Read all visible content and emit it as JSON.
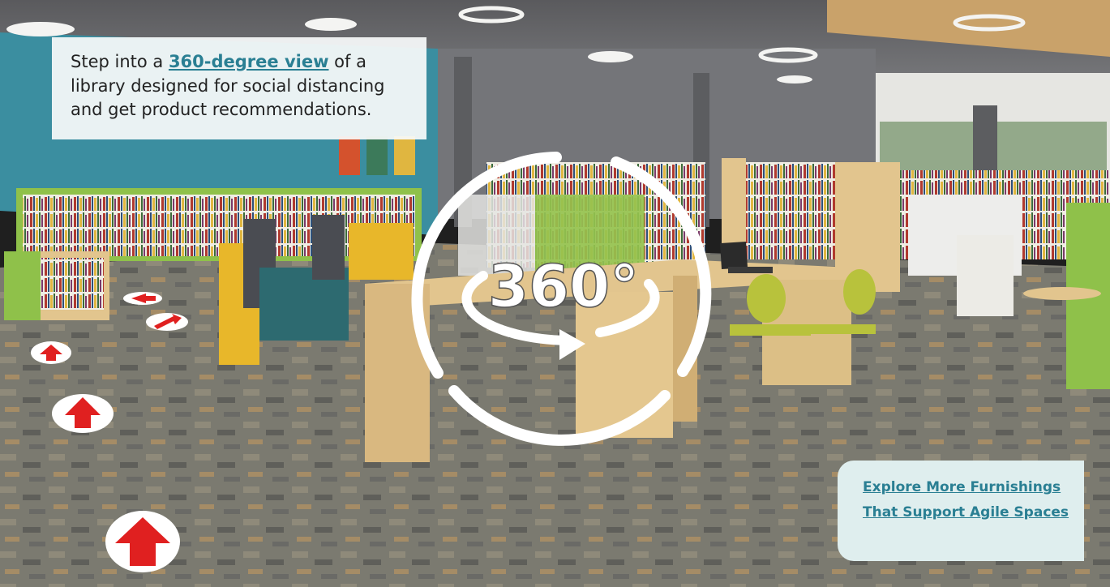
{
  "tour": {
    "intro_before": "Step into a ",
    "intro_link": "360-degree view",
    "intro_after": " of a library designed for social distancing and get product recommendations.",
    "badge_label": "360°"
  },
  "explore": {
    "line1": "Explore More Furnishings ",
    "line2": "That Support Agile Spaces"
  },
  "colors": {
    "accent": "#2a7f93",
    "top_bar": "#1e8c96",
    "floor_arrow": "#e02020"
  }
}
